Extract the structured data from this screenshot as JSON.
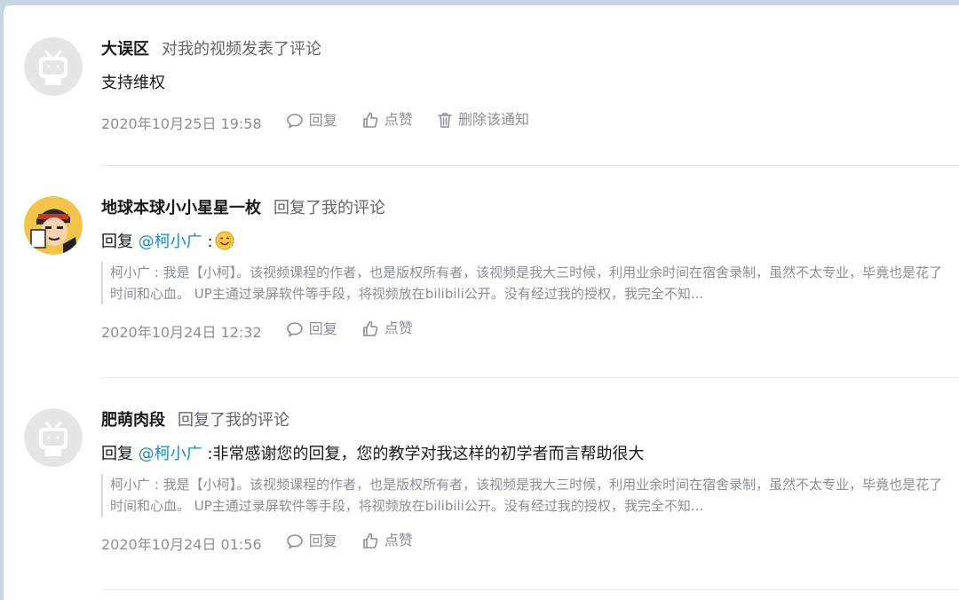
{
  "notifications": [
    {
      "username": "大误区",
      "action": "对我的视频发表了评论",
      "reply_prefix": "",
      "mention": "",
      "separator": "",
      "text": "支持维权",
      "quote": "",
      "time": "2020年10月25日 19:58",
      "reply_label": "回复",
      "like_label": "点赞",
      "delete_label": "删除该通知",
      "avatar": "default-tv-avatar"
    },
    {
      "username": "地球本球小小星星一枚",
      "action": "回复了我的评论",
      "reply_prefix": "回复 ",
      "mention": "@柯小广",
      "separator": " :",
      "text": "",
      "emoji": "smile-emoji",
      "quote": "柯小广 : 我是【小柯】。该视频课程的作者，也是版权所有者，该视频是我大三时候，利用业余时间在宿舍录制，虽然不太专业，毕竟也是花了时间和心血。 UP主通过录屏软件等手段，将视频放在bilibili公开。没有经过我的授权，我完全不知...",
      "time": "2020年10月24日 12:32",
      "reply_label": "回复",
      "like_label": "点赞",
      "avatar": "cartoon-avatar"
    },
    {
      "username": "肥萌肉段",
      "action": "回复了我的评论",
      "reply_prefix": "回复 ",
      "mention": "@柯小广",
      "separator": " :",
      "text": "非常感谢您的回复，您的教学对我这样的初学者而言帮助很大",
      "quote": "柯小广 : 我是【小柯】。该视频课程的作者，也是版权所有者，该视频是我大三时候，利用业余时间在宿舍录制，虽然不太专业，毕竟也是花了时间和心血。 UP主通过录屏软件等手段，将视频放在bilibili公开。没有经过我的授权，我完全不知...",
      "time": "2020年10月24日 01:56",
      "reply_label": "回复",
      "like_label": "点赞",
      "avatar": "default-tv-avatar"
    }
  ],
  "colors": {
    "mention": "#178bcf",
    "username": "#18191c",
    "meta": "#8a8f97"
  }
}
